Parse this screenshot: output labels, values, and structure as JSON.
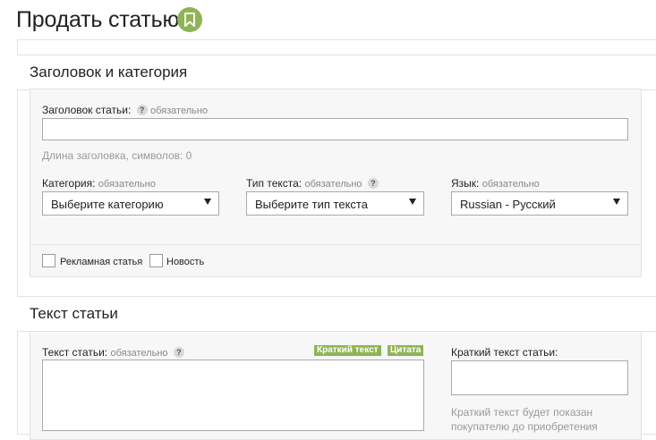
{
  "page": {
    "title": "Продать статью",
    "badge_icon": "bookmark-icon",
    "accent_color": "#8fb456"
  },
  "section_title_category": {
    "title": "Заголовок и категория",
    "title_field": {
      "label": "Заголовок статьи:",
      "required": "обязательно",
      "value": "",
      "length_hint": "Длина заголовка, символов: 0"
    },
    "category": {
      "label": "Категория:",
      "required": "обязательно",
      "selected": "Выберите категорию"
    },
    "text_type": {
      "label": "Тип текста:",
      "required": "обязательно",
      "selected": "Выберите тип текста"
    },
    "language": {
      "label": "Язык:",
      "required": "обязательно",
      "selected": "Russian - Русский"
    },
    "checkboxes": [
      {
        "label": "Рекламная статья",
        "checked": false
      },
      {
        "label": "Новость",
        "checked": false
      }
    ]
  },
  "section_text": {
    "title": "Текст статьи",
    "text_field": {
      "label": "Текст статьи:",
      "required": "обязательно",
      "value": ""
    },
    "tags": [
      "Краткий текст",
      "Цитата"
    ],
    "short_text": {
      "label": "Краткий текст статьи:",
      "value": "",
      "hint_line1": "Краткий текст будет показан",
      "hint_line2": "покупателю до приобретения"
    }
  },
  "help_glyph": "?"
}
